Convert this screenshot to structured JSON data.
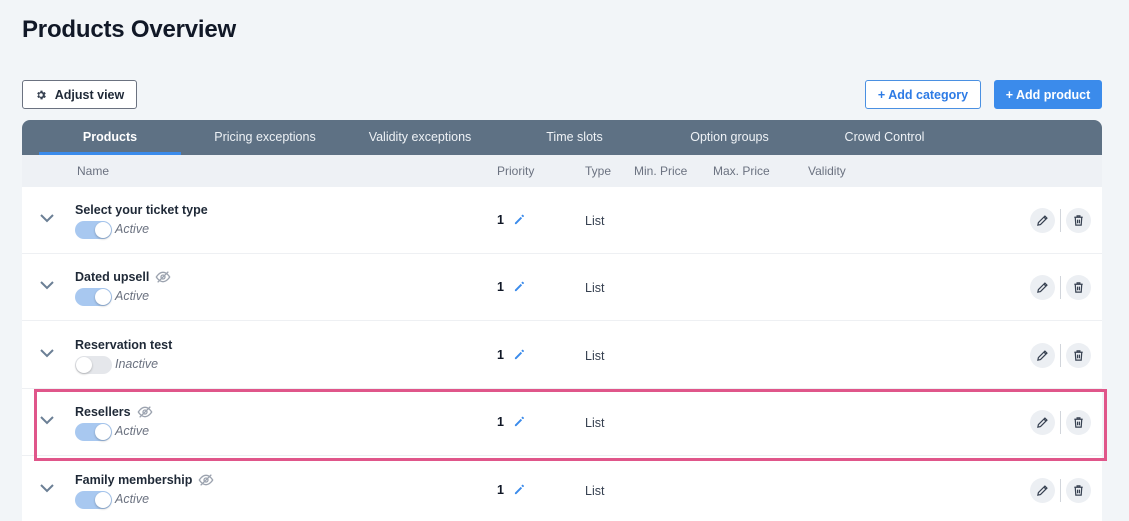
{
  "page": {
    "title": "Products Overview"
  },
  "toolbar": {
    "adjust_view_label": "Adjust view",
    "add_category_label": "+ Add category",
    "add_product_label": "+ Add product"
  },
  "tabs": [
    {
      "label": "Products",
      "active": true
    },
    {
      "label": "Pricing exceptions",
      "active": false
    },
    {
      "label": "Validity exceptions",
      "active": false
    },
    {
      "label": "Time slots",
      "active": false
    },
    {
      "label": "Option groups",
      "active": false
    },
    {
      "label": "Crowd Control",
      "active": false
    }
  ],
  "columns": {
    "name": "Name",
    "priority": "Priority",
    "type": "Type",
    "min_price": "Min. Price",
    "max_price": "Max. Price",
    "validity": "Validity"
  },
  "rows": [
    {
      "name": "Select your ticket type",
      "hidden_icon": false,
      "active": true,
      "status": "Active",
      "priority": "1",
      "type": "List"
    },
    {
      "name": "Dated upsell",
      "hidden_icon": true,
      "active": true,
      "status": "Active",
      "priority": "1",
      "type": "List"
    },
    {
      "name": "Reservation test",
      "hidden_icon": false,
      "active": false,
      "status": "Inactive",
      "priority": "1",
      "type": "List"
    },
    {
      "name": "Resellers",
      "hidden_icon": true,
      "active": true,
      "status": "Active",
      "priority": "1",
      "type": "List",
      "highlighted": true
    },
    {
      "name": "Family membership",
      "hidden_icon": true,
      "active": true,
      "status": "Active",
      "priority": "1",
      "type": "List"
    }
  ],
  "colors": {
    "accent": "#3b8beb",
    "tabbar": "#5e7184",
    "highlight": "#e0568a",
    "toggle_on": "#a8c8f0"
  },
  "icons": {
    "adjust_view": "gear-icon",
    "expand": "chevron-down-icon",
    "hidden": "eye-slash-icon",
    "edit_priority": "pencil-icon",
    "edit": "pencil-icon",
    "delete": "trash-icon"
  }
}
